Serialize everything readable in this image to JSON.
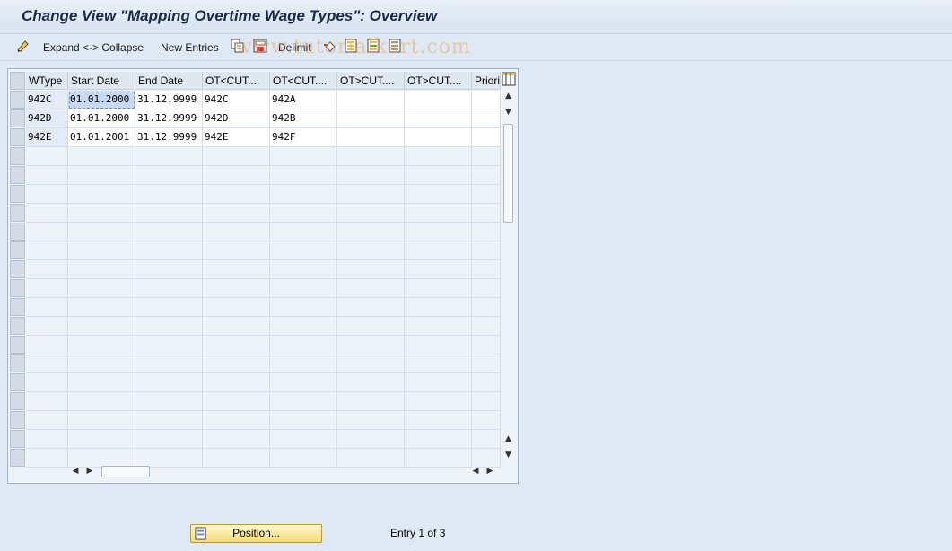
{
  "window": {
    "title": "Change View \"Mapping Overtime Wage Types\": Overview"
  },
  "toolbar": {
    "expand_collapse": "Expand <-> Collapse",
    "new_entries": "New Entries",
    "delimit": "Delimit",
    "watermark": "www.tutorialkart.com"
  },
  "table": {
    "headers": [
      "WType",
      "Start Date",
      "End Date",
      "OT<CUT....",
      "OT<CUT....",
      "OT>CUT....",
      "OT>CUT....",
      "Priorit"
    ],
    "rows": [
      [
        "942C",
        "01.01.2000",
        "31.12.9999",
        "942C",
        "942A",
        "",
        "",
        ""
      ],
      [
        "942D",
        "01.01.2000",
        "31.12.9999",
        "942D",
        "942B",
        "",
        "",
        ""
      ],
      [
        "942E",
        "01.01.2001",
        "31.12.9999",
        "942E",
        "942F",
        "",
        "",
        ""
      ]
    ]
  },
  "footer": {
    "position_button": "Position...",
    "entry_info": "Entry 1 of 3"
  },
  "colors": {
    "accent_button": "#f5d97a",
    "background": "#dfe9f5",
    "title_text": "#1a2a44"
  }
}
